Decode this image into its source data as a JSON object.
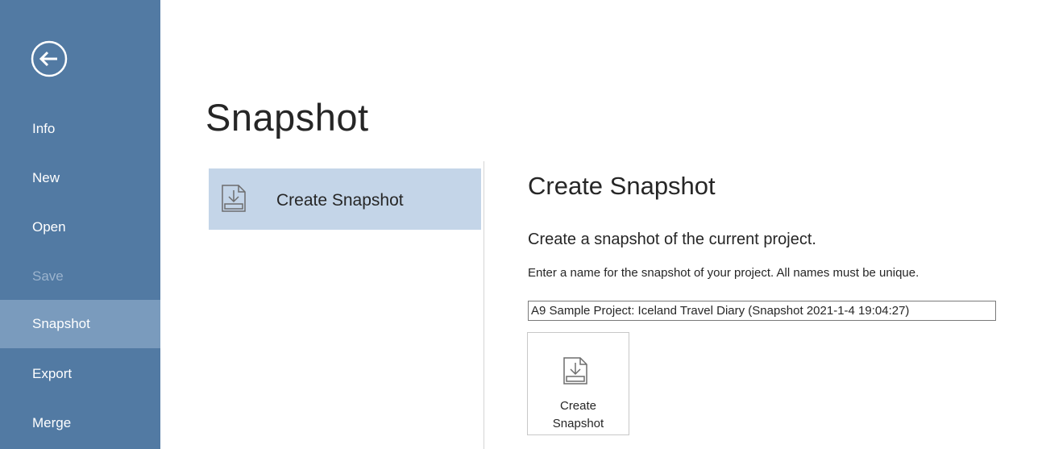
{
  "sidebar": {
    "back_icon": "arrow-left-circle-icon",
    "items": [
      {
        "label": "Info",
        "state": "normal"
      },
      {
        "label": "New",
        "state": "normal"
      },
      {
        "label": "Open",
        "state": "normal"
      },
      {
        "label": "Save",
        "state": "disabled"
      },
      {
        "label": "Snapshot",
        "state": "active"
      },
      {
        "label": "Export",
        "state": "normal"
      },
      {
        "label": "Merge",
        "state": "normal"
      }
    ],
    "colors": {
      "background": "#527aa3",
      "active": "#7a9bbd",
      "disabled_text": "#9bb3cd"
    }
  },
  "main": {
    "title": "Snapshot",
    "options": [
      {
        "label": "Create Snapshot",
        "icon": "create-snapshot-icon",
        "selected": true
      }
    ],
    "panel": {
      "title": "Create Snapshot",
      "subtitle": "Create a snapshot of the current project.",
      "description": "Enter a name for the snapshot of your project. All names must be unique.",
      "name_value": "A9 Sample Project: Iceland Travel Diary (Snapshot 2021-1-4 19:04:27)",
      "button_line1": "Create",
      "button_line2": "Snapshot"
    },
    "colors": {
      "selected_option": "#c4d5e8"
    }
  }
}
